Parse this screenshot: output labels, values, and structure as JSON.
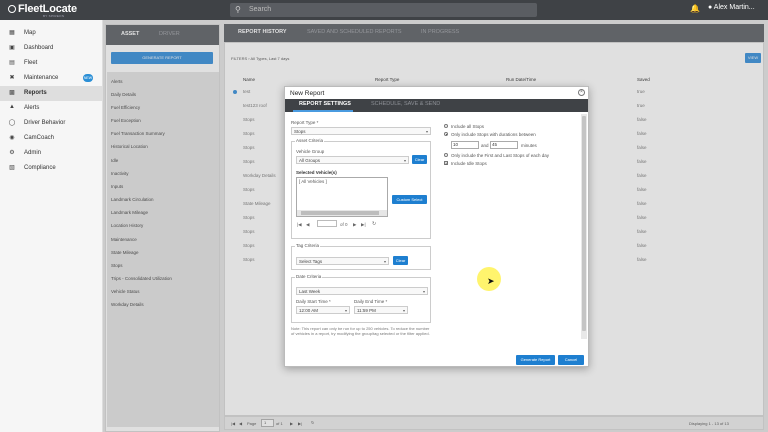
{
  "app": {
    "logo": "FleetLocate",
    "logo_sub": "BY SPIREON",
    "user": "Alex Martin..."
  },
  "search": {
    "placeholder": "Search"
  },
  "sidebar": {
    "items": [
      {
        "label": "Map",
        "icon": "map-icon"
      },
      {
        "label": "Dashboard",
        "icon": "dashboard-icon"
      },
      {
        "label": "Fleet",
        "icon": "fleet-icon"
      },
      {
        "label": "Maintenance",
        "icon": "wrench-icon",
        "badge": "NEW"
      },
      {
        "label": "Reports",
        "icon": "reports-icon"
      },
      {
        "label": "Alerts",
        "icon": "alert-icon"
      },
      {
        "label": "Driver Behavior",
        "icon": "driver-icon"
      },
      {
        "label": "CamCoach",
        "icon": "camera-icon"
      },
      {
        "label": "Admin",
        "icon": "gear-icon"
      },
      {
        "label": "Compliance",
        "icon": "compliance-icon"
      }
    ]
  },
  "asset_panel": {
    "tab_asset": "ASSET",
    "tab_driver": "DRIVER",
    "generate_label": "GENERATE REPORT",
    "items": [
      "Alerts",
      "Daily Details",
      "Fuel Efficiency",
      "Fuel Exception",
      "Fuel Transaction Summary",
      "Historical Location",
      "Idle",
      "Inactivity",
      "Inputs",
      "Landmark Circulation",
      "Landmark Mileage",
      "Location History",
      "Maintenance",
      "State Mileage",
      "Stops",
      "Trips - Consolidated Utilization",
      "Vehicle Status",
      "Workday Details"
    ]
  },
  "report_tabs": [
    "REPORT HISTORY",
    "SAVED AND SCHEDULED REPORTS",
    "IN PROGRESS"
  ],
  "report_area": {
    "filters": "FILTERS  ›  All Types, Last 7 days",
    "view_label": "VIEW",
    "headers": {
      "name": "Name",
      "type": "Report Type",
      "date": "Run Date/Time",
      "saved": "Saved"
    },
    "rows": [
      {
        "name": "test",
        "saved": "true"
      },
      {
        "name": "test123 roof",
        "saved": "true"
      },
      {
        "name": "Stops",
        "saved": "false"
      },
      {
        "name": "Stops",
        "saved": "false"
      },
      {
        "name": "Stops",
        "saved": "false"
      },
      {
        "name": "Stops",
        "saved": "false"
      },
      {
        "name": "Workday Details",
        "saved": "false"
      },
      {
        "name": "Stops",
        "saved": "false"
      },
      {
        "name": "State Mileage",
        "saved": "false"
      },
      {
        "name": "Stops",
        "saved": "false"
      },
      {
        "name": "Stops",
        "saved": "false"
      },
      {
        "name": "Stops",
        "saved": "false"
      },
      {
        "name": "Stops",
        "saved": "false"
      }
    ],
    "pager_page": "Page",
    "pager_input": "1",
    "pager_of": "of 1",
    "pager_display": "Displaying 1 - 13 of 13"
  },
  "modal": {
    "title": "New Report",
    "tabs": [
      "REPORT SETTINGS",
      "SCHEDULE, SAVE & SEND"
    ],
    "report_type_label": "Report Type *",
    "report_type_value": "Stops",
    "asset_criteria": "Asset Criteria",
    "vehicle_group_label": "Vehicle Group",
    "vehicle_group_value": "All Groups",
    "clear_label": "Clear",
    "selected_vehicles_label": "Selected Vehicle(s)",
    "selected_vehicles_item": "[ All Vehicles ]",
    "custom_select_label": "Custom Select",
    "list_pager_of": "of 0",
    "tag_criteria": "Tag Criteria",
    "tag_value": "Select Tags",
    "date_criteria": "Date Criteria",
    "date_value": "Last Week",
    "start_label": "Daily Start Time *",
    "start_value": "12:00 AM",
    "end_label": "Daily End Time *",
    "end_value": "11:59 PM",
    "note": "Note: This report can only be run for up to 250 vehicles. To reduce the number of vehicles in a report, try modifying the group/tag selected or the filter applied.",
    "opt_all": "Include all Stops",
    "opt_duration": "Only include Stops with durations between",
    "min_value": "10",
    "and_label": "and",
    "max_value": "45",
    "minutes_label": "minutes",
    "opt_first_last": "Only include the First and Last Stops of each day",
    "opt_idle": "Include Idle Stops",
    "generate_label": "Generate Report",
    "cancel_label": "Cancel"
  }
}
